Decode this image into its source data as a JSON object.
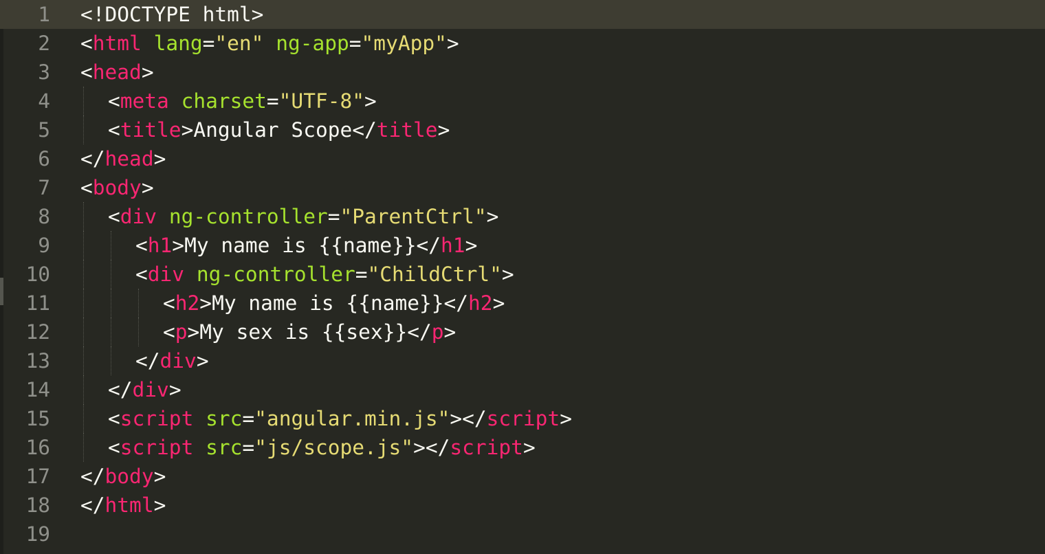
{
  "editor": {
    "theme_colors": {
      "background": "#272822",
      "current_line": "#3e3d32",
      "gutter_text": "#8f908a",
      "tag": "#f92672",
      "attribute": "#a6e22e",
      "string": "#e6db74",
      "text": "#f8f8f2"
    },
    "current_line_number": 1,
    "lines": [
      {
        "number": "1",
        "indent": 0,
        "tokens": [
          {
            "t": "pun",
            "v": "<!DOCTYPE html>"
          }
        ]
      },
      {
        "number": "2",
        "indent": 0,
        "tokens": [
          {
            "t": "pun",
            "v": "<"
          },
          {
            "t": "tag",
            "v": "html"
          },
          {
            "t": "pun",
            "v": " "
          },
          {
            "t": "attr",
            "v": "lang"
          },
          {
            "t": "pun",
            "v": "="
          },
          {
            "t": "str",
            "v": "\"en\""
          },
          {
            "t": "pun",
            "v": " "
          },
          {
            "t": "attr",
            "v": "ng-app"
          },
          {
            "t": "pun",
            "v": "="
          },
          {
            "t": "str",
            "v": "\"myApp\""
          },
          {
            "t": "pun",
            "v": ">"
          }
        ]
      },
      {
        "number": "3",
        "indent": 0,
        "tokens": [
          {
            "t": "pun",
            "v": "<"
          },
          {
            "t": "tag",
            "v": "head"
          },
          {
            "t": "pun",
            "v": ">"
          }
        ]
      },
      {
        "number": "4",
        "indent": 1,
        "tokens": [
          {
            "t": "pun",
            "v": "<"
          },
          {
            "t": "tag",
            "v": "meta"
          },
          {
            "t": "pun",
            "v": " "
          },
          {
            "t": "attr",
            "v": "charset"
          },
          {
            "t": "pun",
            "v": "="
          },
          {
            "t": "str",
            "v": "\"UTF-8\""
          },
          {
            "t": "pun",
            "v": ">"
          }
        ]
      },
      {
        "number": "5",
        "indent": 1,
        "tokens": [
          {
            "t": "pun",
            "v": "<"
          },
          {
            "t": "tag",
            "v": "title"
          },
          {
            "t": "pun",
            "v": ">"
          },
          {
            "t": "txt",
            "v": "Angular Scope"
          },
          {
            "t": "pun",
            "v": "</"
          },
          {
            "t": "tag",
            "v": "title"
          },
          {
            "t": "pun",
            "v": ">"
          }
        ]
      },
      {
        "number": "6",
        "indent": 0,
        "tokens": [
          {
            "t": "pun",
            "v": "</"
          },
          {
            "t": "tag",
            "v": "head"
          },
          {
            "t": "pun",
            "v": ">"
          }
        ]
      },
      {
        "number": "7",
        "indent": 0,
        "tokens": [
          {
            "t": "pun",
            "v": "<"
          },
          {
            "t": "tag",
            "v": "body"
          },
          {
            "t": "pun",
            "v": ">"
          }
        ]
      },
      {
        "number": "8",
        "indent": 1,
        "tokens": [
          {
            "t": "pun",
            "v": "<"
          },
          {
            "t": "tag",
            "v": "div"
          },
          {
            "t": "pun",
            "v": " "
          },
          {
            "t": "attr",
            "v": "ng-controller"
          },
          {
            "t": "pun",
            "v": "="
          },
          {
            "t": "str",
            "v": "\"ParentCtrl\""
          },
          {
            "t": "pun",
            "v": ">"
          }
        ]
      },
      {
        "number": "9",
        "indent": 2,
        "tokens": [
          {
            "t": "pun",
            "v": "<"
          },
          {
            "t": "tag",
            "v": "h1"
          },
          {
            "t": "pun",
            "v": ">"
          },
          {
            "t": "txt",
            "v": "My name is {{name}}"
          },
          {
            "t": "pun",
            "v": "</"
          },
          {
            "t": "tag",
            "v": "h1"
          },
          {
            "t": "pun",
            "v": ">"
          }
        ]
      },
      {
        "number": "10",
        "indent": 2,
        "tokens": [
          {
            "t": "pun",
            "v": "<"
          },
          {
            "t": "tag",
            "v": "div"
          },
          {
            "t": "pun",
            "v": " "
          },
          {
            "t": "attr",
            "v": "ng-controller"
          },
          {
            "t": "pun",
            "v": "="
          },
          {
            "t": "str",
            "v": "\"ChildCtrl\""
          },
          {
            "t": "pun",
            "v": ">"
          }
        ]
      },
      {
        "number": "11",
        "indent": 3,
        "tokens": [
          {
            "t": "pun",
            "v": "<"
          },
          {
            "t": "tag",
            "v": "h2"
          },
          {
            "t": "pun",
            "v": ">"
          },
          {
            "t": "txt",
            "v": "My name is {{name}}"
          },
          {
            "t": "pun",
            "v": "</"
          },
          {
            "t": "tag",
            "v": "h2"
          },
          {
            "t": "pun",
            "v": ">"
          }
        ]
      },
      {
        "number": "12",
        "indent": 3,
        "tokens": [
          {
            "t": "pun",
            "v": "<"
          },
          {
            "t": "tag",
            "v": "p"
          },
          {
            "t": "pun",
            "v": ">"
          },
          {
            "t": "txt",
            "v": "My sex is {{sex}}"
          },
          {
            "t": "pun",
            "v": "</"
          },
          {
            "t": "tag",
            "v": "p"
          },
          {
            "t": "pun",
            "v": ">"
          }
        ]
      },
      {
        "number": "13",
        "indent": 2,
        "tokens": [
          {
            "t": "pun",
            "v": "</"
          },
          {
            "t": "tag",
            "v": "div"
          },
          {
            "t": "pun",
            "v": ">"
          }
        ]
      },
      {
        "number": "14",
        "indent": 1,
        "tokens": [
          {
            "t": "pun",
            "v": "</"
          },
          {
            "t": "tag",
            "v": "div"
          },
          {
            "t": "pun",
            "v": ">"
          }
        ]
      },
      {
        "number": "15",
        "indent": 1,
        "tokens": [
          {
            "t": "pun",
            "v": "<"
          },
          {
            "t": "tag",
            "v": "script"
          },
          {
            "t": "pun",
            "v": " "
          },
          {
            "t": "attr",
            "v": "src"
          },
          {
            "t": "pun",
            "v": "="
          },
          {
            "t": "str",
            "v": "\"angular.min.js\""
          },
          {
            "t": "pun",
            "v": "></"
          },
          {
            "t": "tag",
            "v": "script"
          },
          {
            "t": "pun",
            "v": ">"
          }
        ]
      },
      {
        "number": "16",
        "indent": 1,
        "tokens": [
          {
            "t": "pun",
            "v": "<"
          },
          {
            "t": "tag",
            "v": "script"
          },
          {
            "t": "pun",
            "v": " "
          },
          {
            "t": "attr",
            "v": "src"
          },
          {
            "t": "pun",
            "v": "="
          },
          {
            "t": "str",
            "v": "\"js/scope.js\""
          },
          {
            "t": "pun",
            "v": "></"
          },
          {
            "t": "tag",
            "v": "script"
          },
          {
            "t": "pun",
            "v": ">"
          }
        ]
      },
      {
        "number": "17",
        "indent": 0,
        "tokens": [
          {
            "t": "pun",
            "v": "</"
          },
          {
            "t": "tag",
            "v": "body"
          },
          {
            "t": "pun",
            "v": ">"
          }
        ]
      },
      {
        "number": "18",
        "indent": 0,
        "tokens": [
          {
            "t": "pun",
            "v": "</"
          },
          {
            "t": "tag",
            "v": "html"
          },
          {
            "t": "pun",
            "v": ">"
          }
        ]
      },
      {
        "number": "19",
        "indent": 0,
        "tokens": []
      }
    ]
  }
}
